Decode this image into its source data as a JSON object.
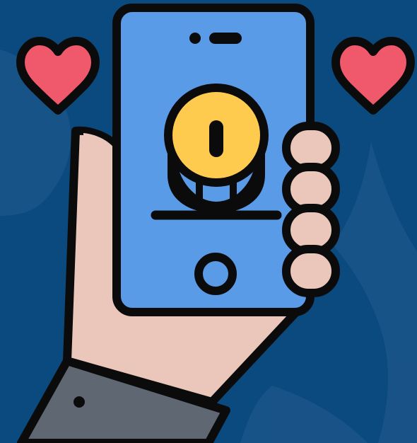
{
  "colors": {
    "background": "#0a4a7e",
    "background_shape": "#2c5f94",
    "outline": "#0b0b0b",
    "phone_screen": "#5a9be8",
    "coin": "#ffcb4f",
    "heart": "#f0586c",
    "skin": "#eac7ba",
    "sleeve": "#5f6872"
  },
  "icons": {
    "main": "hand-holding-phone-icon",
    "coin": "coin-icon",
    "heart_left": "heart-icon",
    "heart_right": "heart-icon",
    "home_button": "home-button-icon"
  }
}
